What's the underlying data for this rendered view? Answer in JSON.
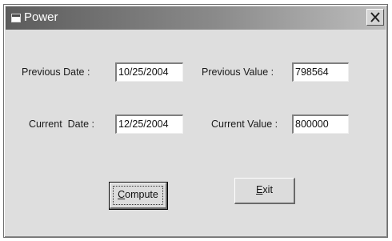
{
  "window": {
    "title": "Power"
  },
  "titlebar": {
    "icon": "app-window-icon",
    "close_icon": "close-icon"
  },
  "form": {
    "previous_date": {
      "label": "Previous Date :",
      "value": "10/25/2004"
    },
    "previous_value": {
      "label": "Previous Value :",
      "value": "798564"
    },
    "current_date": {
      "label": "Current  Date :",
      "value": "12/25/2004"
    },
    "current_value": {
      "label": "Current Value :",
      "value": "800000"
    }
  },
  "buttons": {
    "compute": {
      "mnemonic": "C",
      "rest": "ompute"
    },
    "exit": {
      "mnemonic": "E",
      "rest": "xit"
    }
  }
}
